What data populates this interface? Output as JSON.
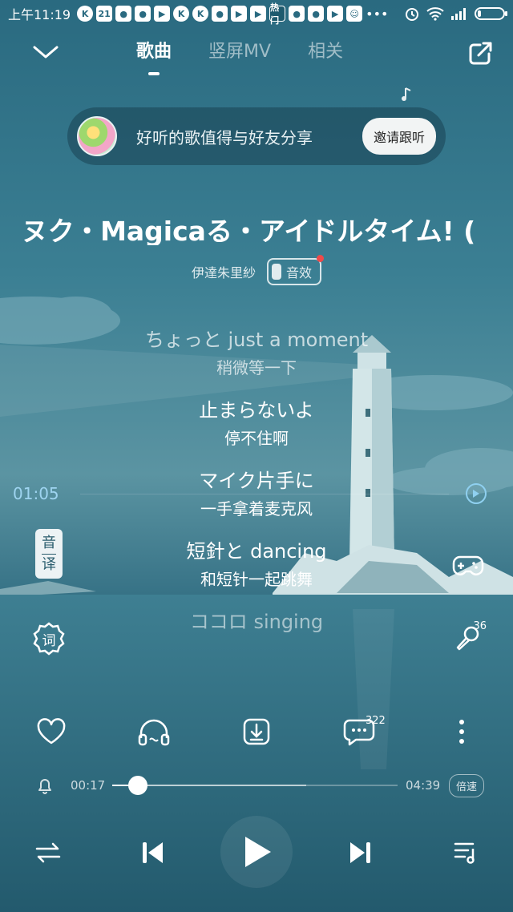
{
  "status_bar": {
    "time": "上午11:19",
    "notif_icons": [
      "K",
      "21",
      "●",
      "●",
      "▶",
      "K",
      "K",
      "●",
      "▶",
      "▶",
      "热门",
      "●",
      "●",
      "▶",
      "☺"
    ],
    "battery_fraction": 0.12
  },
  "nav": {
    "tabs": [
      {
        "label": "歌曲",
        "active": true
      },
      {
        "label": "竖屏MV",
        "active": false
      },
      {
        "label": "相关",
        "active": false
      }
    ]
  },
  "share_banner": {
    "text": "好听的歌值得与好友分享",
    "button_label": "邀请跟听"
  },
  "song": {
    "title": "ヌク・Magicaる・アイドルタイム! (",
    "artist": "伊達朱里紗",
    "effect_label": "音效"
  },
  "lyrics": [
    {
      "orig": "ちょっと just a moment",
      "trans": "稍微等一下"
    },
    {
      "orig": "止まらないよ",
      "trans": "停不住啊"
    },
    {
      "orig": "マイク片手に",
      "trans": "一手拿着麦克风"
    },
    {
      "orig": "短針と dancing",
      "trans": "和短针一起跳舞"
    },
    {
      "orig": "ココロ singing",
      "trans": ""
    }
  ],
  "lyric_timestamp": "01:05",
  "side_controls": {
    "yin_label": "音",
    "yi_label": "译",
    "ci_label": "词",
    "mic_count": "36"
  },
  "actions": {
    "comment_count": "322"
  },
  "progress": {
    "current": "00:17",
    "total": "04:39",
    "played_fraction": 0.09,
    "buffered_fraction": 0.68,
    "speed_label": "倍速"
  },
  "colors": {
    "accent_time": "#9ed4f0",
    "effect_dot": "#f04a4a"
  }
}
